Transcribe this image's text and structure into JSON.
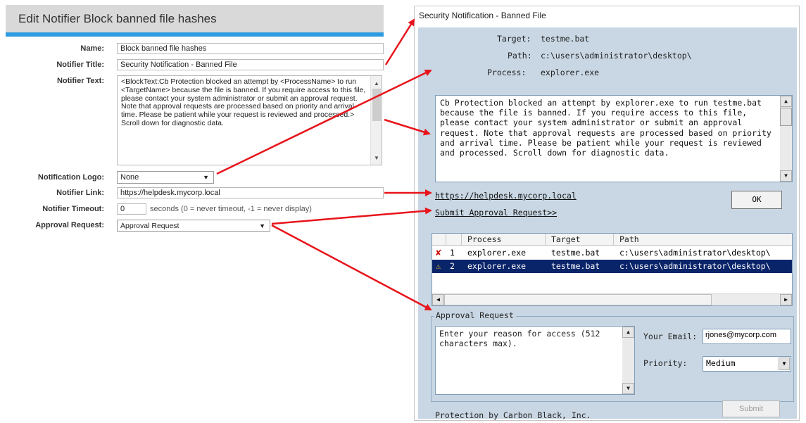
{
  "left_panel": {
    "title": "Edit Notifier Block banned file hashes",
    "fields": {
      "name_label": "Name:",
      "name_value": "Block banned file hashes",
      "notifier_title_label": "Notifier Title:",
      "notifier_title_value": "Security Notification - Banned File",
      "notifier_text_label": "Notifier Text:",
      "notifier_text_value": "<BlockText:Cb Protection blocked an attempt by <ProcessName> to run <TargetName> because the file is banned.  If you require access to this file, please contact your system administrator or submit an approval request.  Note that approval requests are processed based on priority and arrival time. Please be patient while your request is reviewed and processed.>  Scroll down for diagnostic data.",
      "notification_logo_label": "Notification Logo:",
      "notification_logo_value": "None",
      "notifier_link_label": "Notifier Link:",
      "notifier_link_value": "https://helpdesk.mycorp.local",
      "notifier_timeout_label": "Notifier Timeout:",
      "notifier_timeout_value": "0",
      "notifier_timeout_hint": "seconds (0 = never timeout, -1 = never display)",
      "approval_request_label": "Approval Request:",
      "approval_request_value": "Approval Request"
    }
  },
  "dialog": {
    "title": "Security Notification - Banned File",
    "target_label": "Target:",
    "target_value": "testme.bat",
    "path_label": "Path:",
    "path_value": "c:\\users\\administrator\\desktop\\",
    "process_label": "Process:",
    "process_value": "explorer.exe",
    "message": "Cb Protection blocked an attempt by explorer.exe to run testme.bat because the file is banned.  If you require access to this file, please contact your system administrator or submit an approval request.  Note that approval requests are processed based on priority and arrival time.  Please be patient while your request is reviewed and processed.  Scroll down for diagnostic data.",
    "link": "https://helpdesk.mycorp.local",
    "submit_approval_link": "Submit Approval Request>>",
    "ok_label": "OK",
    "table": {
      "columns": [
        "Process",
        "Target",
        "Path"
      ],
      "rows": [
        {
          "num": "1",
          "process": "explorer.exe",
          "target": "testme.bat",
          "path": "c:\\users\\administrator\\desktop\\",
          "icon": "red-x-icon",
          "selected": false
        },
        {
          "num": "2",
          "process": "explorer.exe",
          "target": "testme.bat",
          "path": "c:\\users\\administrator\\desktop\\",
          "icon": "warning-icon",
          "selected": true
        }
      ]
    },
    "approval": {
      "legend": "Approval Request",
      "reason_placeholder": "Enter your reason for access (512 characters max).",
      "email_label": "Your Email:",
      "email_value": "rjones@mycorp.com",
      "priority_label": "Priority:",
      "priority_value": "Medium",
      "submit_label": "Submit"
    },
    "footer": "Protection by Carbon Black, Inc."
  },
  "colors": {
    "header_bar": "#2f9be0",
    "dialog_body": "#c9d7e4",
    "selected_row": "#0a246a",
    "arrow": "#e8141b"
  }
}
